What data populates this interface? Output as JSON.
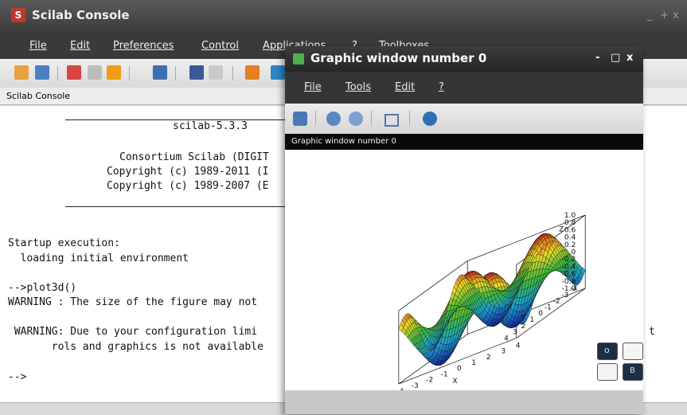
{
  "main": {
    "title": "Scilab Console",
    "window_controls": [
      "_",
      "+",
      "x"
    ],
    "menu": [
      "File",
      "Edit",
      "Preferences",
      "Control",
      "Applications",
      "?",
      "Toolboxes"
    ],
    "panel_label": "Scilab Console",
    "console_lines": [
      "scilab-5.3.3",
      "Consortium Scilab (DIGIT",
      "Copyright (c) 1989-2011 (I",
      "Copyright (c) 1989-2007 (E",
      "Startup execution:",
      "  loading initial environment",
      "-->plot3d()",
      "WARNING : The size of the figure may not",
      " WARNING: Due to your configuration limi",
      "       rols and graphics is not available",
      "-->"
    ],
    "overflow_char": "t"
  },
  "graphic": {
    "title": "Graphic window number 0",
    "window_controls": [
      "-",
      "□",
      "x"
    ],
    "menu": [
      "File",
      "Tools",
      "Edit",
      "?"
    ],
    "caption": "Graphic window number 0",
    "z_ticks": [
      "1.0",
      "0.8",
      "0.6",
      "0.4",
      "0.2",
      "0",
      "-0.2",
      "-0.4",
      "-0.6",
      "-0.8",
      "-1.0"
    ],
    "y_ticks": [
      "-4",
      "-3",
      "-2",
      "-1",
      "0",
      "1",
      "2",
      "3",
      "4"
    ],
    "x_ticks": [
      "4",
      "3",
      "2",
      "1",
      "0",
      "-1",
      "-2",
      "-3",
      "-4"
    ],
    "z_label": "Z",
    "y_label": "Y",
    "x_label": "X"
  },
  "overlay": {
    "btn_a": "o",
    "btn_d": "B"
  },
  "colors": {
    "titlebar": "#3c3c3c",
    "menubar": "#353535",
    "surface_high": "#2e7d32",
    "surface_low": "#1565c0"
  }
}
